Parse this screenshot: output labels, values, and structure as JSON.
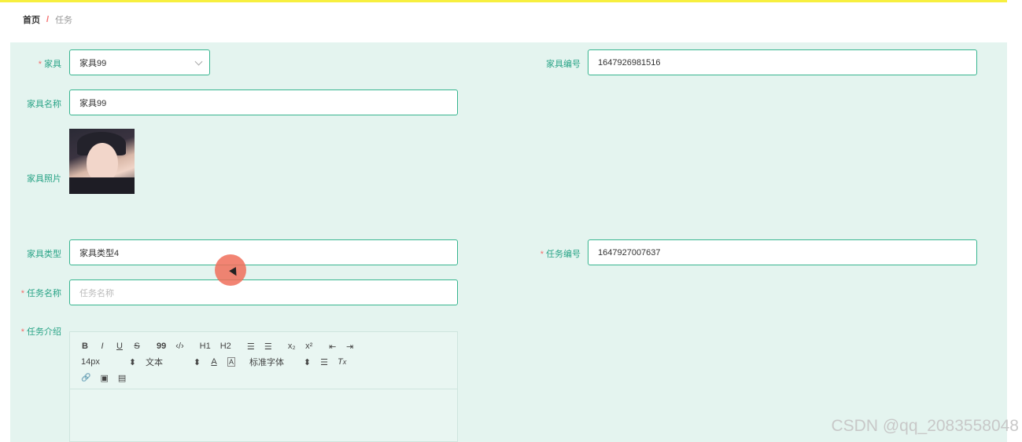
{
  "breadcrumb": {
    "home": "首页",
    "separator": "/",
    "current": "任务"
  },
  "form": {
    "furniture": {
      "label": "家具",
      "required": "*",
      "value": "家具99"
    },
    "furniture_no": {
      "label": "家具编号",
      "value": "1647926981516"
    },
    "furniture_name": {
      "label": "家具名称",
      "value": "家具99"
    },
    "furniture_photo": {
      "label": "家具照片"
    },
    "furniture_type": {
      "label": "家具类型",
      "value": "家具类型4"
    },
    "task_no": {
      "label": "任务编号",
      "required": "*",
      "value": "1647927007637"
    },
    "task_name": {
      "label": "任务名称",
      "required": "*",
      "placeholder": "任务名称"
    },
    "task_intro": {
      "label": "任务介绍",
      "required": "*"
    }
  },
  "editor": {
    "row1": [
      "B",
      "I",
      "U",
      "S",
      "99",
      "‹/›",
      "H1",
      "H2",
      "☰",
      "☰",
      "x₂",
      "x²",
      "⇤",
      "⇥"
    ],
    "row2": {
      "font_size": "14px",
      "text_type": "文本",
      "font_family": "标准字体"
    },
    "row3": [
      "🔗",
      "▣",
      "▤"
    ]
  },
  "watermark": "CSDN @qq_2083558048"
}
